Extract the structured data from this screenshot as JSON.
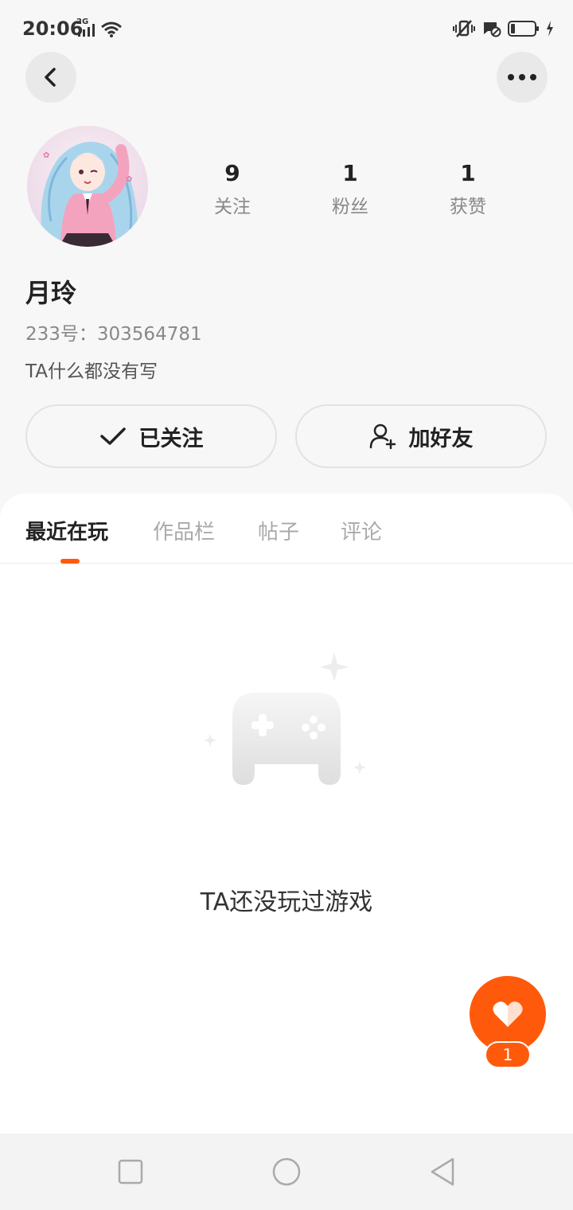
{
  "status_bar": {
    "time": "20:06",
    "network": "2G",
    "icons": [
      "signal-icon",
      "wifi-icon",
      "vibrate-icon",
      "message-blocked-icon",
      "battery-icon",
      "charging-icon"
    ]
  },
  "header": {
    "back_icon": "chevron-left-icon",
    "more_icon": "more-horizontal-icon"
  },
  "profile": {
    "avatar_icon": "user-avatar",
    "stats": [
      {
        "value": "9",
        "label": "关注"
      },
      {
        "value": "1",
        "label": "粉丝"
      },
      {
        "value": "1",
        "label": "获赞"
      }
    ],
    "name": "月玲",
    "uid_line": "233号：303564781",
    "bio": "TA什么都没有写"
  },
  "actions": {
    "follow_label": "已关注",
    "follow_icon": "check-icon",
    "add_friend_label": "加好友",
    "add_friend_icon": "user-plus-icon"
  },
  "tabs": [
    {
      "label": "最近在玩",
      "active": true
    },
    {
      "label": "作品栏",
      "active": false
    },
    {
      "label": "帖子",
      "active": false
    },
    {
      "label": "评论",
      "active": false
    }
  ],
  "empty_state": {
    "icon": "gamepad-icon",
    "text": "TA还没玩过游戏"
  },
  "like_fab": {
    "icon": "heart-icon",
    "count": "1"
  },
  "colors": {
    "accent": "#ff5a0b",
    "background": "#f7f7f7"
  }
}
